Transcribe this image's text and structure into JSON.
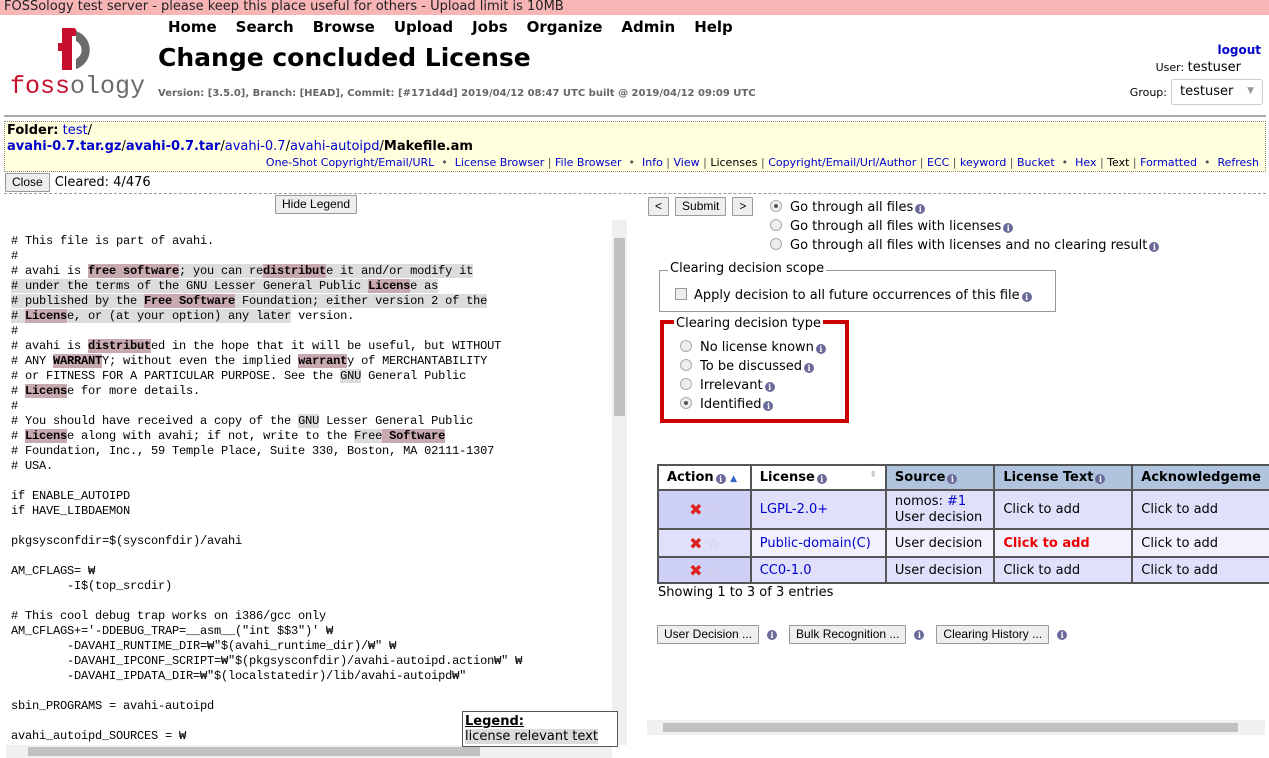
{
  "banner": "FOSSology test server - please keep this place useful for others - Upload limit is 10MB",
  "logo": {
    "text": "fossology",
    "colors": {
      "red": "#c8102e",
      "gray": "#6b6b6b"
    }
  },
  "nav": [
    "Home",
    "Search",
    "Browse",
    "Upload",
    "Jobs",
    "Organize",
    "Admin",
    "Help"
  ],
  "title": "Change concluded License",
  "version": "Version: [3.5.0], Branch: [HEAD], Commit: [#171d4d] 2019/04/12 08:47 UTC built @ 2019/04/12 09:09 UTC",
  "user": {
    "logout": "logout",
    "user_label": "User:",
    "user": "testuser",
    "group_label": "Group:",
    "group": "testuser"
  },
  "folder": {
    "label": "Folder:",
    "path": [
      "test",
      "/"
    ],
    "crumbs": [
      {
        "t": "avahi-0.7.tar.gz",
        "link": true,
        "bold": true
      },
      {
        "t": "/",
        "link": false
      },
      {
        "t": "avahi-0.7.tar",
        "link": true,
        "bold": true
      },
      {
        "t": "/",
        "link": false
      },
      {
        "t": "avahi-0.7",
        "link": true
      },
      {
        "t": "/",
        "link": false
      },
      {
        "t": "avahi-autoipd",
        "link": true
      },
      {
        "t": "/",
        "link": false
      },
      {
        "t": "Makefile.am",
        "link": false,
        "bold": true
      }
    ],
    "tools": [
      {
        "t": "One-Shot Copyright/Email/URL",
        "link": true
      },
      {
        "t": "  •  ",
        "sep": true
      },
      {
        "t": "License Browser",
        "link": true
      },
      {
        "t": " | ",
        "sep": true
      },
      {
        "t": "File Browser",
        "link": true
      },
      {
        "t": "  •  ",
        "sep": true
      },
      {
        "t": "Info",
        "link": true
      },
      {
        "t": " | ",
        "sep": true
      },
      {
        "t": "View",
        "link": true
      },
      {
        "t": " | ",
        "sep": true
      },
      {
        "t": "Licenses",
        "link": false
      },
      {
        "t": " | ",
        "sep": true
      },
      {
        "t": "Copyright/Email/Url/Author",
        "link": true
      },
      {
        "t": " | ",
        "sep": true
      },
      {
        "t": "ECC",
        "link": true
      },
      {
        "t": " | ",
        "sep": true
      },
      {
        "t": "keyword",
        "link": true
      },
      {
        "t": " | ",
        "sep": true
      },
      {
        "t": "Bucket",
        "link": true
      },
      {
        "t": "  •  ",
        "sep": true
      },
      {
        "t": "Hex",
        "link": true
      },
      {
        "t": " | ",
        "sep": true
      },
      {
        "t": "Text",
        "link": false
      },
      {
        "t": " | ",
        "sep": true
      },
      {
        "t": "Formatted",
        "link": true
      },
      {
        "t": "  •  ",
        "sep": true
      },
      {
        "t": "Refresh",
        "link": true
      }
    ]
  },
  "close_label": "Close",
  "cleared": "Cleared: 4/476",
  "hide_legend": "Hide Legend",
  "code_lines": [
    [
      [
        "# This file is part of avahi.",
        "n"
      ]
    ],
    [
      [
        "#",
        "n"
      ]
    ],
    [
      [
        "# avahi is ",
        "n"
      ],
      [
        "free software",
        "k"
      ],
      [
        "; you can re",
        "g"
      ],
      [
        "distribut",
        "k"
      ],
      [
        "e it and/or modify it",
        "g"
      ]
    ],
    [
      [
        "# under the terms of the GNU Lesser General Public ",
        "g"
      ],
      [
        "Licens",
        "k"
      ],
      [
        "e as",
        "g"
      ]
    ],
    [
      [
        "# published by the ",
        "g"
      ],
      [
        "Free Software",
        "k"
      ],
      [
        " Foundation; either version 2 of the",
        "g"
      ]
    ],
    [
      [
        "# ",
        "g"
      ],
      [
        "Licens",
        "k"
      ],
      [
        "e, or (at your option) any later",
        "g"
      ],
      [
        " version.",
        "n"
      ]
    ],
    [
      [
        "#",
        "n"
      ]
    ],
    [
      [
        "# avahi is ",
        "n"
      ],
      [
        "distribut",
        "k"
      ],
      [
        "ed in the hope that it will be useful, but WITHOUT",
        "n"
      ]
    ],
    [
      [
        "# ANY ",
        "n"
      ],
      [
        "WARRANT",
        "k"
      ],
      [
        "Y; without even the implied ",
        "n"
      ],
      [
        "warrant",
        "k"
      ],
      [
        "y of MERCHANTABILITY",
        "n"
      ]
    ],
    [
      [
        "# or FITNESS FOR A PARTICULAR PURPOSE. See the ",
        "n"
      ],
      [
        "GNU",
        "g"
      ],
      [
        " General Public",
        "n"
      ]
    ],
    [
      [
        "# ",
        "n"
      ],
      [
        "Licens",
        "k"
      ],
      [
        "e for more details.",
        "n"
      ]
    ],
    [
      [
        "#",
        "n"
      ]
    ],
    [
      [
        "# You should have received a copy of the ",
        "n"
      ],
      [
        "GNU",
        "g"
      ],
      [
        " Lesser General Public",
        "n"
      ]
    ],
    [
      [
        "# ",
        "n"
      ],
      [
        "Licens",
        "k"
      ],
      [
        "e along with avahi; if not, write to the ",
        "n"
      ],
      [
        "Free",
        "g"
      ],
      [
        " Software",
        "k"
      ]
    ],
    [
      [
        "# Foundation, Inc., 59 Temple Place, Suite 330, Boston, MA 02111-1307",
        "n"
      ]
    ],
    [
      [
        "# USA.",
        "n"
      ]
    ],
    [
      [
        "",
        "n"
      ]
    ],
    [
      [
        "if ENABLE_AUTOIPD",
        "n"
      ]
    ],
    [
      [
        "if HAVE_LIBDAEMON",
        "n"
      ]
    ],
    [
      [
        "",
        "n"
      ]
    ],
    [
      [
        "pkgsysconfdir=$(sysconfdir)/avahi",
        "n"
      ]
    ],
    [
      [
        "",
        "n"
      ]
    ],
    [
      [
        "AM_CFLAGS= ₩",
        "n"
      ]
    ],
    [
      [
        "        -I$(top_srcdir)",
        "n"
      ]
    ],
    [
      [
        "",
        "n"
      ]
    ],
    [
      [
        "# This cool debug trap works on i386/gcc only",
        "n"
      ]
    ],
    [
      [
        "AM_CFLAGS+='-DDEBUG_TRAP=__asm__(\"int $$3\")' ₩",
        "n"
      ]
    ],
    [
      [
        "        -DAVAHI_RUNTIME_DIR=₩\"$(avahi_runtime_dir)/₩\" ₩",
        "n"
      ]
    ],
    [
      [
        "        -DAVAHI_IPCONF_SCRIPT=₩\"$(pkgsysconfdir)/avahi-autoipd.action₩\" ₩",
        "n"
      ]
    ],
    [
      [
        "        -DAVAHI_IPDATA_DIR=₩\"$(localstatedir)/lib/avahi-autoipd₩\"",
        "n"
      ]
    ],
    [
      [
        "",
        "n"
      ]
    ],
    [
      [
        "sbin_PROGRAMS = avahi-autoipd",
        "n"
      ]
    ],
    [
      [
        "",
        "n"
      ]
    ],
    [
      [
        "avahi_autoipd_SOURCES = ₩",
        "n"
      ]
    ]
  ],
  "legend": {
    "title": "Legend:",
    "item": "license relevant text"
  },
  "nav_buttons": {
    "prev": "<",
    "submit": "Submit",
    "next": ">"
  },
  "go_through": [
    {
      "label": "Go through all files",
      "checked": true
    },
    {
      "label": "Go through all files with licenses",
      "checked": false
    },
    {
      "label": "Go through all files with licenses and no clearing result",
      "checked": false
    }
  ],
  "scope": {
    "title": "Clearing decision scope",
    "checkbox": "Apply decision to all future occurrences of this file",
    "checked": false
  },
  "decision_type": {
    "title": "Clearing decision type",
    "highlight_color": "#cc0000",
    "options": [
      {
        "label": "No license known",
        "checked": false
      },
      {
        "label": "To be discussed",
        "checked": false
      },
      {
        "label": "Irrelevant",
        "checked": false
      },
      {
        "label": "Identified",
        "checked": true
      }
    ]
  },
  "table": {
    "headers": [
      "Action",
      "License",
      "Source",
      "License Text",
      "Acknowledgeme"
    ],
    "rows": [
      {
        "license": "LGPL-2.0+",
        "source_prefix": "nomos: ",
        "source_link": "#1",
        "source": "User decision",
        "text": "Click to add",
        "text_red": false,
        "ack": "Click to add"
      },
      {
        "license": "Public-domain(C)",
        "source_prefix": "",
        "source_link": "",
        "source": "User decision",
        "text": "Click to add",
        "text_red": true,
        "ack": "Click to add"
      },
      {
        "license": "CC0-1.0",
        "source_prefix": "",
        "source_link": "",
        "source": "User decision",
        "text": "Click to add",
        "text_red": false,
        "ack": "Click to add"
      }
    ],
    "showing": "Showing 1 to 3 of 3 entries"
  },
  "bottom_buttons": [
    "User Decision ...",
    "Bulk Recognition ...",
    "Clearing History ..."
  ]
}
